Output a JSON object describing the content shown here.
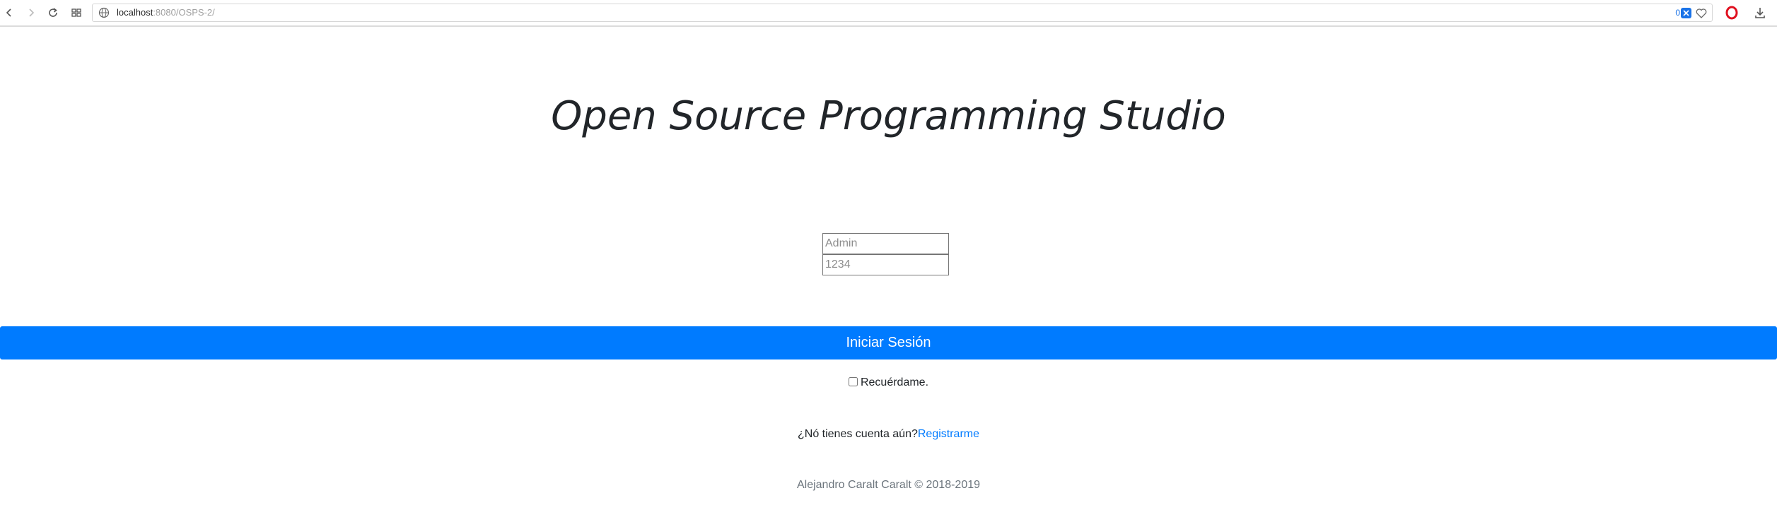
{
  "browser": {
    "url_host": "localhost",
    "url_rest": ":8080/OSPS-2/",
    "adblock_count": "0"
  },
  "page": {
    "title": "Open Source Programming Studio"
  },
  "form": {
    "username_placeholder": "Admin",
    "password_placeholder": "1234",
    "submit_label": "Iniciar Sesión",
    "remember_label": "Recuérdame."
  },
  "register": {
    "prompt": "¿Nó tienes cuenta aún?",
    "link_label": "Registrarme"
  },
  "footer": {
    "text": "Alejandro Caralt Caralt © 2018-2019"
  },
  "colors": {
    "primary": "#007bff",
    "text": "#212529",
    "muted": "#6c757d"
  }
}
